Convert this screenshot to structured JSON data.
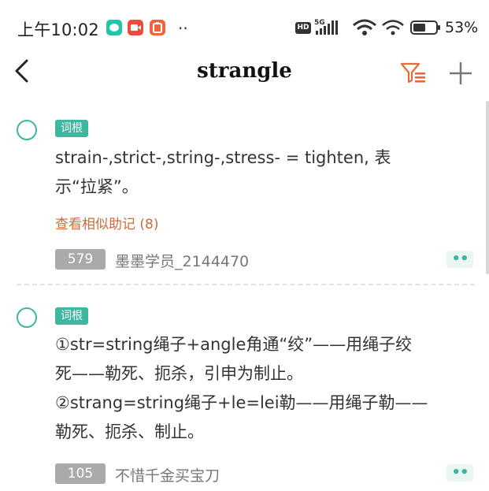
{
  "status_bar": {
    "time": "上午10:02",
    "dots": "··",
    "hd": "HD",
    "network": "5G",
    "battery_percent": "53%"
  },
  "header": {
    "title": "strangle"
  },
  "entries": [
    {
      "tag": "词根",
      "lines": [
        "strain-,strict-,string-,stress- = tighten, 表",
        "示“拉紧”。"
      ],
      "similar_link": "查看相似助记 (8)",
      "count": "579",
      "author": "墨墨学员_2144470"
    },
    {
      "tag": "词根",
      "lines": [
        "①str=string绳子+angle角通“绞”——用绳子绞",
        "死——勒死、扼杀，引申为制止。",
        "②strang=string绳子+le=lei勒——用绳子勒——",
        "勒死、扼杀、制止。"
      ],
      "count": "105",
      "author": "不惜千金买宝刀"
    }
  ],
  "colors": {
    "accent": "#3eb6a0",
    "link": "#d06a3a",
    "count_badge": "#aaaaaa"
  }
}
